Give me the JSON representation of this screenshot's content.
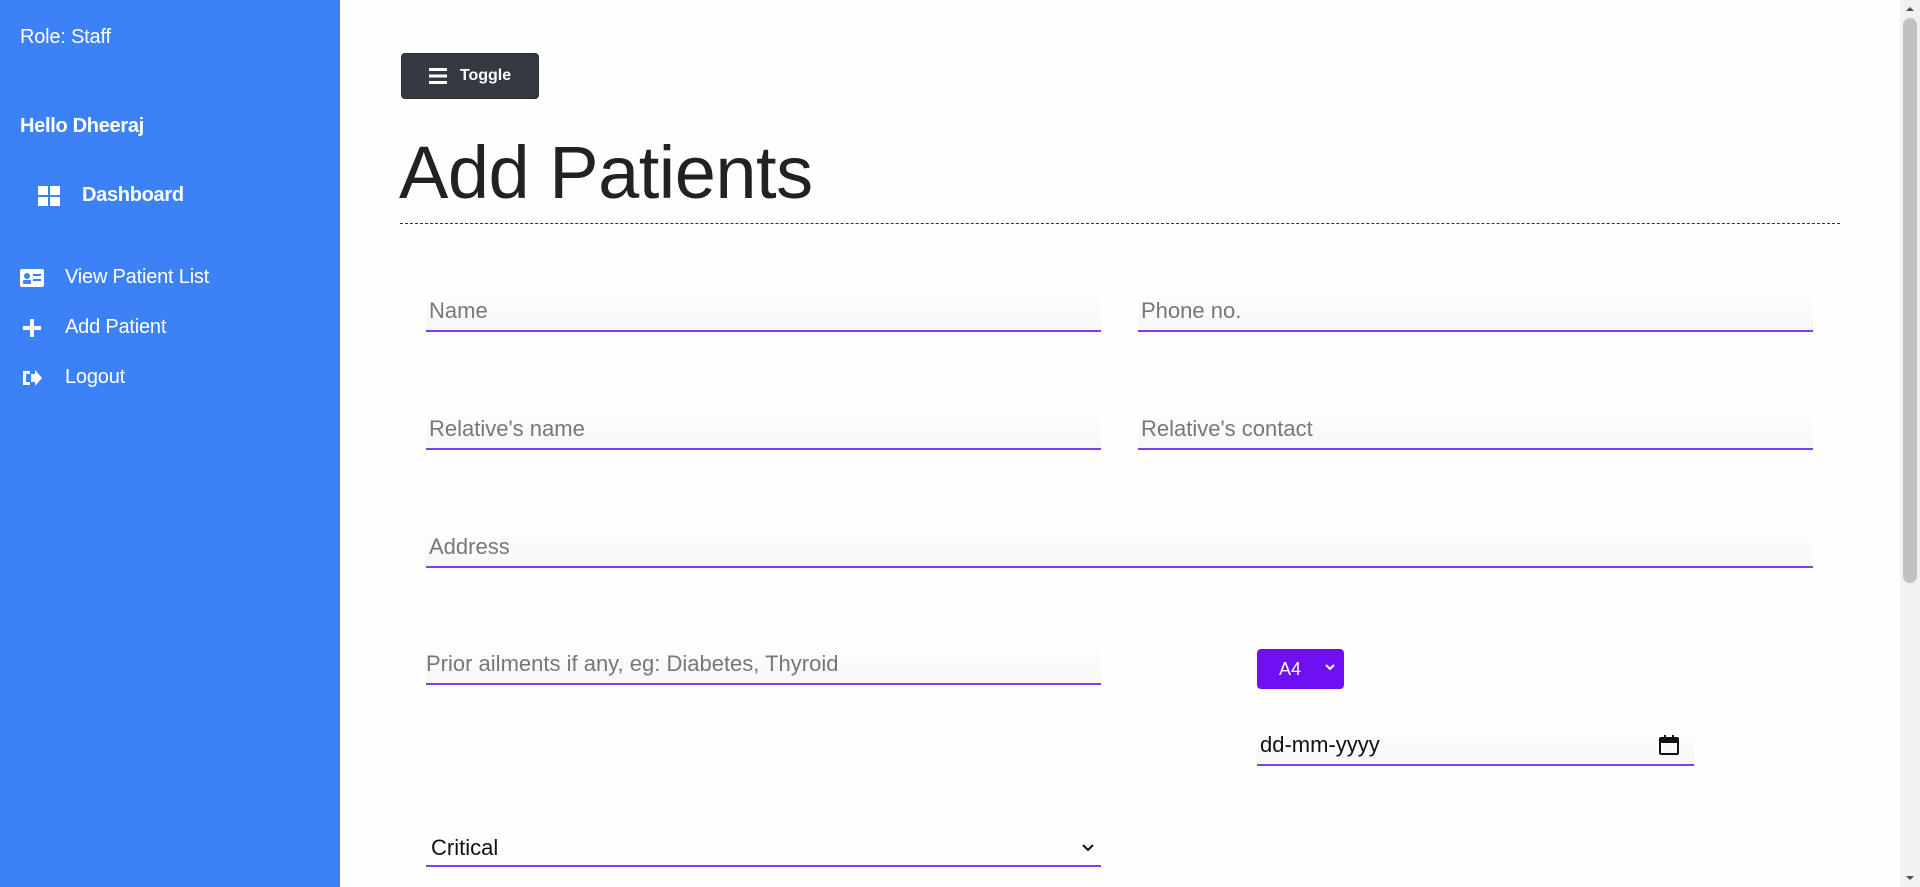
{
  "sidebar": {
    "role": "Role: Staff",
    "greeting": "Hello Dheeraj",
    "dashboard": {
      "label": "Dashboard",
      "icon": "dashboard-grid-icon"
    },
    "items": [
      {
        "label": "View Patient List",
        "icon": "id-card-icon"
      },
      {
        "label": "Add Patient",
        "icon": "plus-icon"
      },
      {
        "label": "Logout",
        "icon": "logout-icon"
      }
    ]
  },
  "toolbar": {
    "toggle_label": "Toggle",
    "toggle_icon": "hamburger-menu-icon"
  },
  "page": {
    "title": "Add Patients"
  },
  "form": {
    "name": {
      "placeholder": "Name",
      "value": ""
    },
    "phone": {
      "placeholder": "Phone no.",
      "value": ""
    },
    "relative_name": {
      "placeholder": "Relative's name",
      "value": ""
    },
    "relative_contact": {
      "placeholder": "Relative's contact",
      "value": ""
    },
    "address": {
      "placeholder": "Address",
      "value": ""
    },
    "prior_ailments": {
      "placeholder": "Prior ailments if any, eg: Diabetes, Thyroid",
      "value": ""
    },
    "ward_select": {
      "value": "A4"
    },
    "date": {
      "value": "dd-mm-yyyy"
    },
    "condition": {
      "value": "Critical"
    }
  },
  "colors": {
    "sidebar_bg": "#3c82f6",
    "accent": "#7e3ff2",
    "select_bg": "#6f10f2",
    "toggle_bg": "#343a40"
  }
}
